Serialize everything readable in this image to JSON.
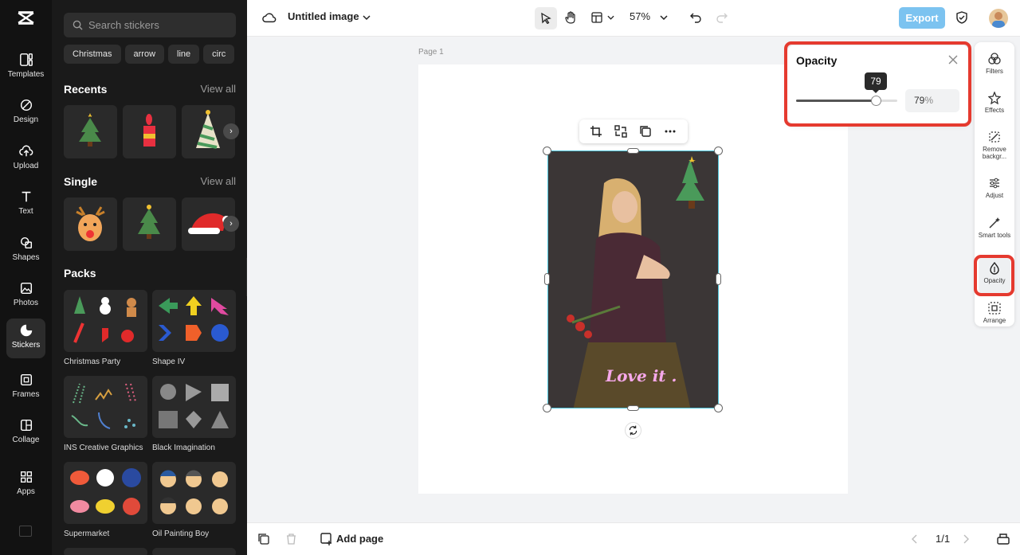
{
  "rail": {
    "items": [
      {
        "label": "Templates",
        "icon": "templates-icon"
      },
      {
        "label": "Design",
        "icon": "design-icon"
      },
      {
        "label": "Upload",
        "icon": "upload-icon"
      },
      {
        "label": "Text",
        "icon": "text-icon"
      },
      {
        "label": "Shapes",
        "icon": "shapes-icon"
      },
      {
        "label": "Photos",
        "icon": "photos-icon"
      },
      {
        "label": "Stickers",
        "icon": "stickers-icon",
        "active": true
      },
      {
        "label": "Frames",
        "icon": "frames-icon"
      },
      {
        "label": "Collage",
        "icon": "collage-icon"
      },
      {
        "label": "Apps",
        "icon": "apps-icon"
      }
    ]
  },
  "panel": {
    "search_placeholder": "Search stickers",
    "chips": [
      "Christmas",
      "arrow",
      "line",
      "circ"
    ],
    "recents": {
      "title": "Recents",
      "view_all": "View all"
    },
    "single": {
      "title": "Single",
      "view_all": "View all"
    },
    "packs": {
      "title": "Packs",
      "items": [
        "Christmas Party",
        "Shape IV",
        "INS Creative Graphics",
        "Black Imagination",
        "Supermarket",
        "Oil Painting Boy"
      ]
    }
  },
  "topbar": {
    "title": "Untitled image",
    "zoom": "57%",
    "export_label": "Export"
  },
  "canvas": {
    "page_label": "Page 1",
    "image_text": "Love it ."
  },
  "opacity_panel": {
    "title": "Opacity",
    "tooltip": "79",
    "value": "79",
    "unit": "%",
    "slider_fraction": 0.79
  },
  "right_panel": {
    "items": [
      {
        "label": "Filters"
      },
      {
        "label": "Effects"
      },
      {
        "label": "Remove backgr..."
      },
      {
        "label": "Adjust"
      },
      {
        "label": "Smart tools"
      },
      {
        "label": "Opacity",
        "active": true
      },
      {
        "label": "Arrange"
      }
    ]
  },
  "bottombar": {
    "add_page": "Add page",
    "page_counter": "1/1"
  },
  "colors": {
    "accent_export": "#7cc3f0",
    "highlight": "#e53a2f",
    "selection": "#4cc3d9"
  }
}
